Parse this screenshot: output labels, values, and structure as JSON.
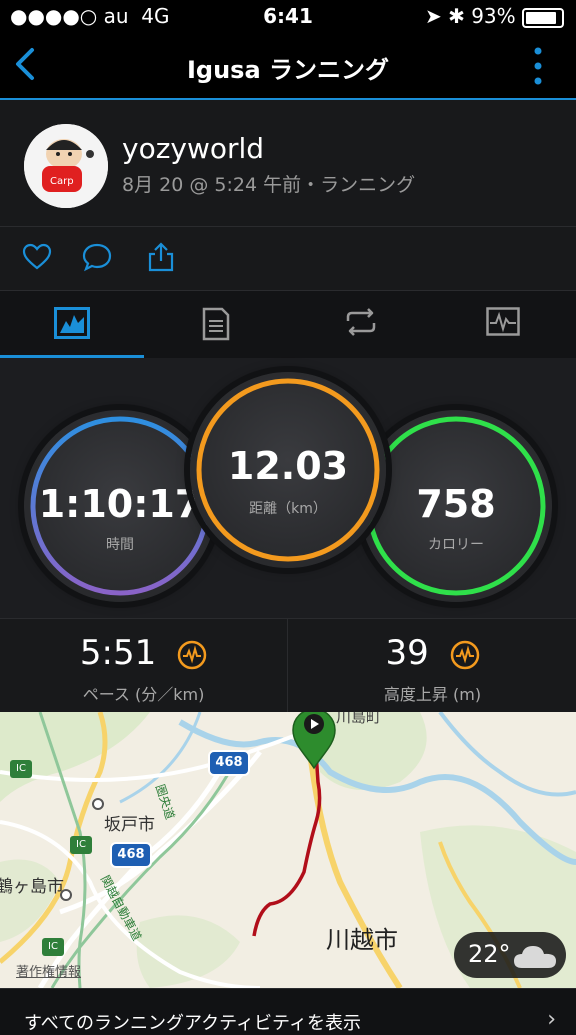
{
  "status_bar": {
    "carrier": "●●●●○ au",
    "network": "4G",
    "time": "6:41",
    "battery": "93%"
  },
  "nav": {
    "title": "Igusa ランニング"
  },
  "profile": {
    "username": "yozyworld",
    "meta": "8月 20 @ 5:24 午前・ランニング"
  },
  "tabs": [
    {
      "name": "overview",
      "active": true
    },
    {
      "name": "details",
      "active": false
    },
    {
      "name": "laps",
      "active": false
    },
    {
      "name": "charts",
      "active": false
    }
  ],
  "stats": {
    "time": {
      "value": "1:10:17",
      "label": "時間",
      "color": "#6e6cd8"
    },
    "distance": {
      "value": "12.03",
      "label": "距離（km）",
      "color": "#f39a1e"
    },
    "calories": {
      "value": "758",
      "label": "カロリー",
      "color": "#2fe04a"
    }
  },
  "pace": {
    "pace": {
      "value": "5:51",
      "label": "ペース (分／km)"
    },
    "elevation": {
      "value": "39",
      "label": "高度上昇 (m)"
    }
  },
  "map": {
    "labels": {
      "sakado": "坂戸市",
      "kawagoe": "川越市",
      "tsurugashima": "鶴ヶ島市",
      "kawashima": "川島町",
      "copyright": "著作権情報",
      "road468a": "468",
      "road468b": "468",
      "ic1": "IC",
      "ic2": "IC",
      "ic3": "IC",
      "ken_o": "圏央道",
      "kanetsu": "関越自動車道"
    },
    "weather": {
      "temp": "22°"
    }
  },
  "footer": {
    "text": "すべてのランニングアクティビティを表示"
  }
}
